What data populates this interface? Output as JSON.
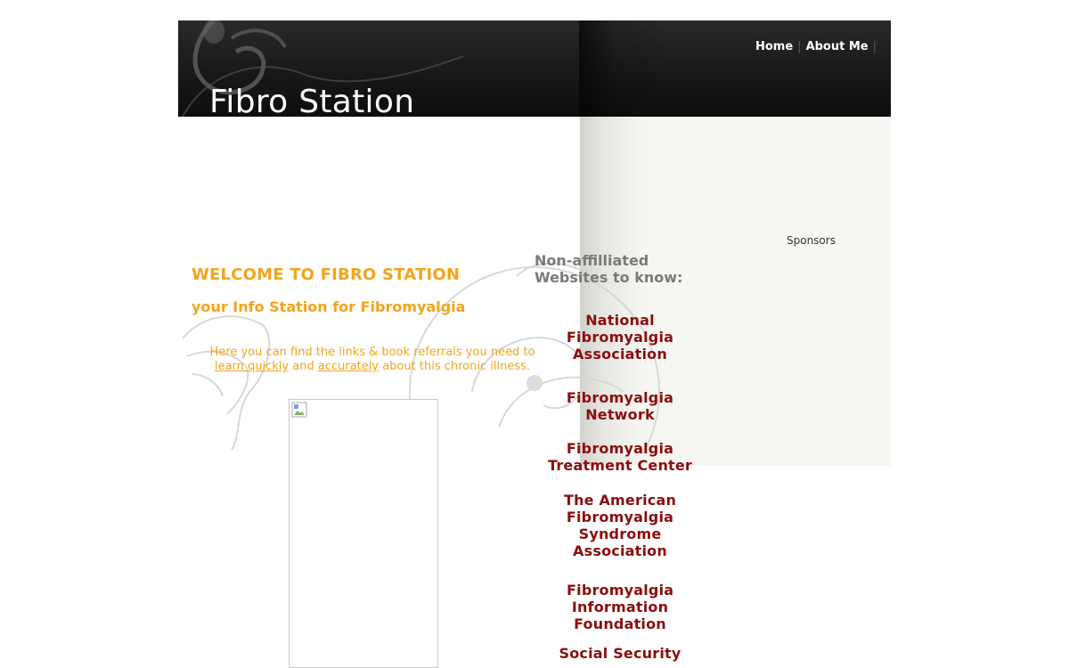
{
  "header": {
    "site_title": "Fibro Station",
    "nav": [
      {
        "label": "Home"
      },
      {
        "label": "About Me"
      }
    ]
  },
  "sidebar": {
    "sponsors_label": "Sponsors"
  },
  "main": {
    "welcome_heading": "WELCOME TO FIBRO STATION",
    "tagline": "your Info Station for Fibromyalgia",
    "intro": {
      "text_before": "Here you can find the links & book referrals you need to",
      "link1": "learn quickly",
      "text_mid": "and",
      "link2": "accurately",
      "text_after": "about this chronic illness."
    }
  },
  "links": {
    "heading_line1": "Non-affilliated",
    "heading_line2": "Websites to know:",
    "items": [
      {
        "label": "National Fibromyalgia Association"
      },
      {
        "label": "Fibromyalgia Network"
      },
      {
        "label": "Fibromyalgia Treatment Center"
      },
      {
        "label": "The American Fibromyalgia Syndrome Association"
      },
      {
        "label": "Fibromyalgia Information Foundation"
      },
      {
        "label": "Social Security"
      }
    ]
  },
  "colors": {
    "accent_orange": "#f3a41c",
    "link_red": "#8b0d0d",
    "header_dark": "#1a1a1a",
    "sidebar_bg": "#f6f6f2"
  },
  "icons": {
    "broken_image": "broken-image-icon",
    "header_swirl": "swirl-ornament-icon",
    "background_swirl": "butterfly-swirl-ornament-icon"
  }
}
